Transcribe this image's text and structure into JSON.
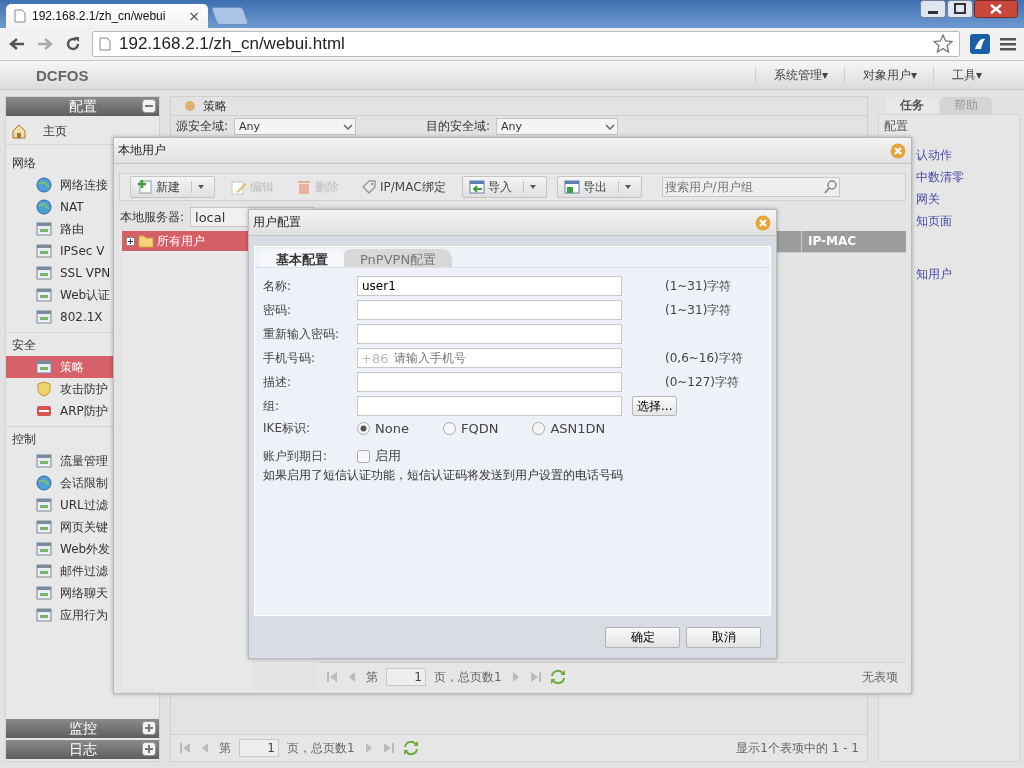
{
  "browser": {
    "tab": {
      "title": "192.168.2.1/zh_cn/webui",
      "close": "×"
    },
    "address": "192.168.2.1/zh_cn/webui.html"
  },
  "app": {
    "logo": "DCFOS",
    "menu": [
      "系统管理▾",
      "对象用户▾",
      "工具▾"
    ]
  },
  "sidebar": {
    "header": {
      "label": "配置",
      "expanded": true
    },
    "home": "主页",
    "groups": [
      {
        "title": "网络",
        "items": [
          {
            "label": "网络连接",
            "selected": false
          },
          {
            "label": "NAT",
            "selected": false
          },
          {
            "label": "路由",
            "selected": false
          },
          {
            "label": "IPSec V",
            "selected": false
          },
          {
            "label": "SSL VPN",
            "selected": false
          },
          {
            "label": "Web认证",
            "selected": false
          },
          {
            "label": "802.1X",
            "selected": false
          }
        ]
      },
      {
        "title": "安全",
        "items": [
          {
            "label": "策略",
            "selected": true
          },
          {
            "label": "攻击防护",
            "selected": false
          },
          {
            "label": "ARP防护",
            "selected": false
          }
        ]
      },
      {
        "title": "控制",
        "items": [
          {
            "label": "流量管理",
            "selected": false
          },
          {
            "label": "会话限制",
            "selected": false
          },
          {
            "label": "URL过滤",
            "selected": false
          },
          {
            "label": "网页关键",
            "selected": false
          },
          {
            "label": "Web外发",
            "selected": false
          },
          {
            "label": "邮件过滤",
            "selected": false
          },
          {
            "label": "网络聊天",
            "selected": false
          },
          {
            "label": "应用行为",
            "selected": false
          }
        ]
      }
    ],
    "footer": [
      {
        "label": "监控",
        "expanded": false
      },
      {
        "label": "日志",
        "expanded": false
      }
    ]
  },
  "main": {
    "title": "策略",
    "filters": [
      {
        "label": "源安全域:",
        "value": "Any"
      },
      {
        "label": "目的安全域:",
        "value": "Any"
      }
    ],
    "pager": {
      "prefix": "第",
      "page": "1",
      "suffix": "页，总页数1",
      "status": "显示1个表项中的 1 - 1"
    }
  },
  "right_panel": {
    "tabs": [
      {
        "label": "任务",
        "selected": true
      },
      {
        "label": "帮助",
        "selected": false
      }
    ],
    "heading": "配置",
    "links": [
      "认动作",
      "中数清零",
      "网关",
      "知页面",
      "知用户"
    ]
  },
  "local_users": {
    "title": "本地用户",
    "toolbar": [
      {
        "label": "新建",
        "kind": "split",
        "disabled": false
      },
      {
        "label": "编辑",
        "kind": "button",
        "disabled": true
      },
      {
        "label": "删除",
        "kind": "button",
        "disabled": true
      },
      {
        "label": "IP/MAC绑定",
        "kind": "button",
        "disabled": false
      },
      {
        "label": "导入",
        "kind": "split",
        "disabled": false
      },
      {
        "label": "导出",
        "kind": "split",
        "disabled": false
      }
    ],
    "search": {
      "placeholder": "搜索用户/用户组"
    },
    "server": {
      "label": "本地服务器:",
      "value": "local"
    },
    "tree": [
      {
        "label": "所有用户",
        "selected": true
      }
    ],
    "columns": [
      "IP-MAC"
    ],
    "pager": {
      "prefix": "第",
      "page": "1",
      "suffix": "页，总页数1",
      "status": "无表项"
    }
  },
  "user_config": {
    "title": "用户配置",
    "tabs": [
      {
        "label": "基本配置",
        "selected": true
      },
      {
        "label": "PnPVPN配置",
        "selected": false
      }
    ],
    "fields": [
      {
        "kind": "text",
        "label": "名称:",
        "value": "user1",
        "hint": "(1~31)字符"
      },
      {
        "kind": "text",
        "label": "密码:",
        "hint": "(1~31)字符"
      },
      {
        "kind": "text",
        "label": "重新输入密码:"
      },
      {
        "kind": "phone",
        "label": "手机号码:",
        "prefix": "+86",
        "placeholder": "请输入手机号",
        "hint": "(0,6~16)字符"
      },
      {
        "kind": "text",
        "label": "描述:",
        "hint": "(0~127)字符"
      },
      {
        "kind": "picker",
        "label": "组:",
        "button": "选择..."
      }
    ],
    "ike": {
      "label": "IKE标识:",
      "options": [
        {
          "label": "None",
          "selected": true
        },
        {
          "label": "FQDN",
          "selected": false
        },
        {
          "label": "ASN1DN",
          "selected": false
        }
      ]
    },
    "expiry": {
      "label": "账户到期日:",
      "option": {
        "label": "启用",
        "checked": false
      }
    },
    "note": "如果启用了短信认证功能，短信认证码将发送到用户设置的电话号码",
    "buttons": [
      "确定",
      "取消"
    ]
  }
}
